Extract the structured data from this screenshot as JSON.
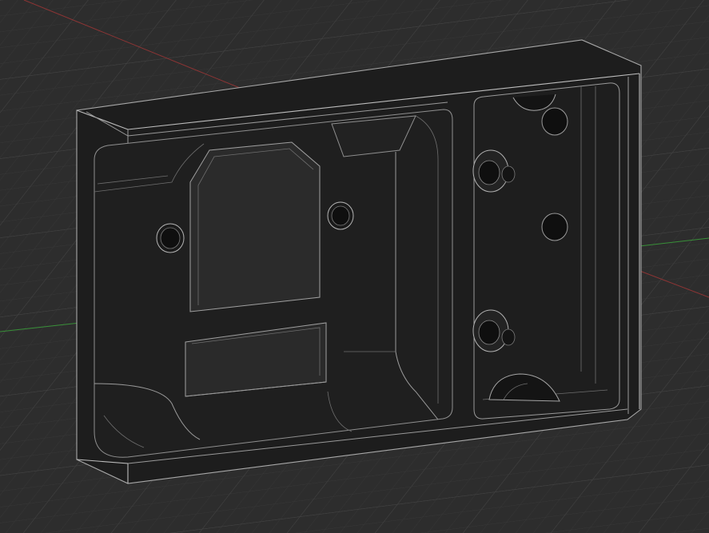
{
  "viewport": {
    "background_color": "#2d2d2d",
    "grid_minor_color": "#3a3a3a",
    "grid_major_color": "#444444",
    "x_axis_color": "#b33a3a",
    "y_axis_color": "#3a9a3a",
    "model_fill_color": "#1c1c1c",
    "model_face_color": "#202020",
    "model_edge_color": "#9a9a9a"
  },
  "model": {
    "name_icon": "enclosure-box-model"
  }
}
